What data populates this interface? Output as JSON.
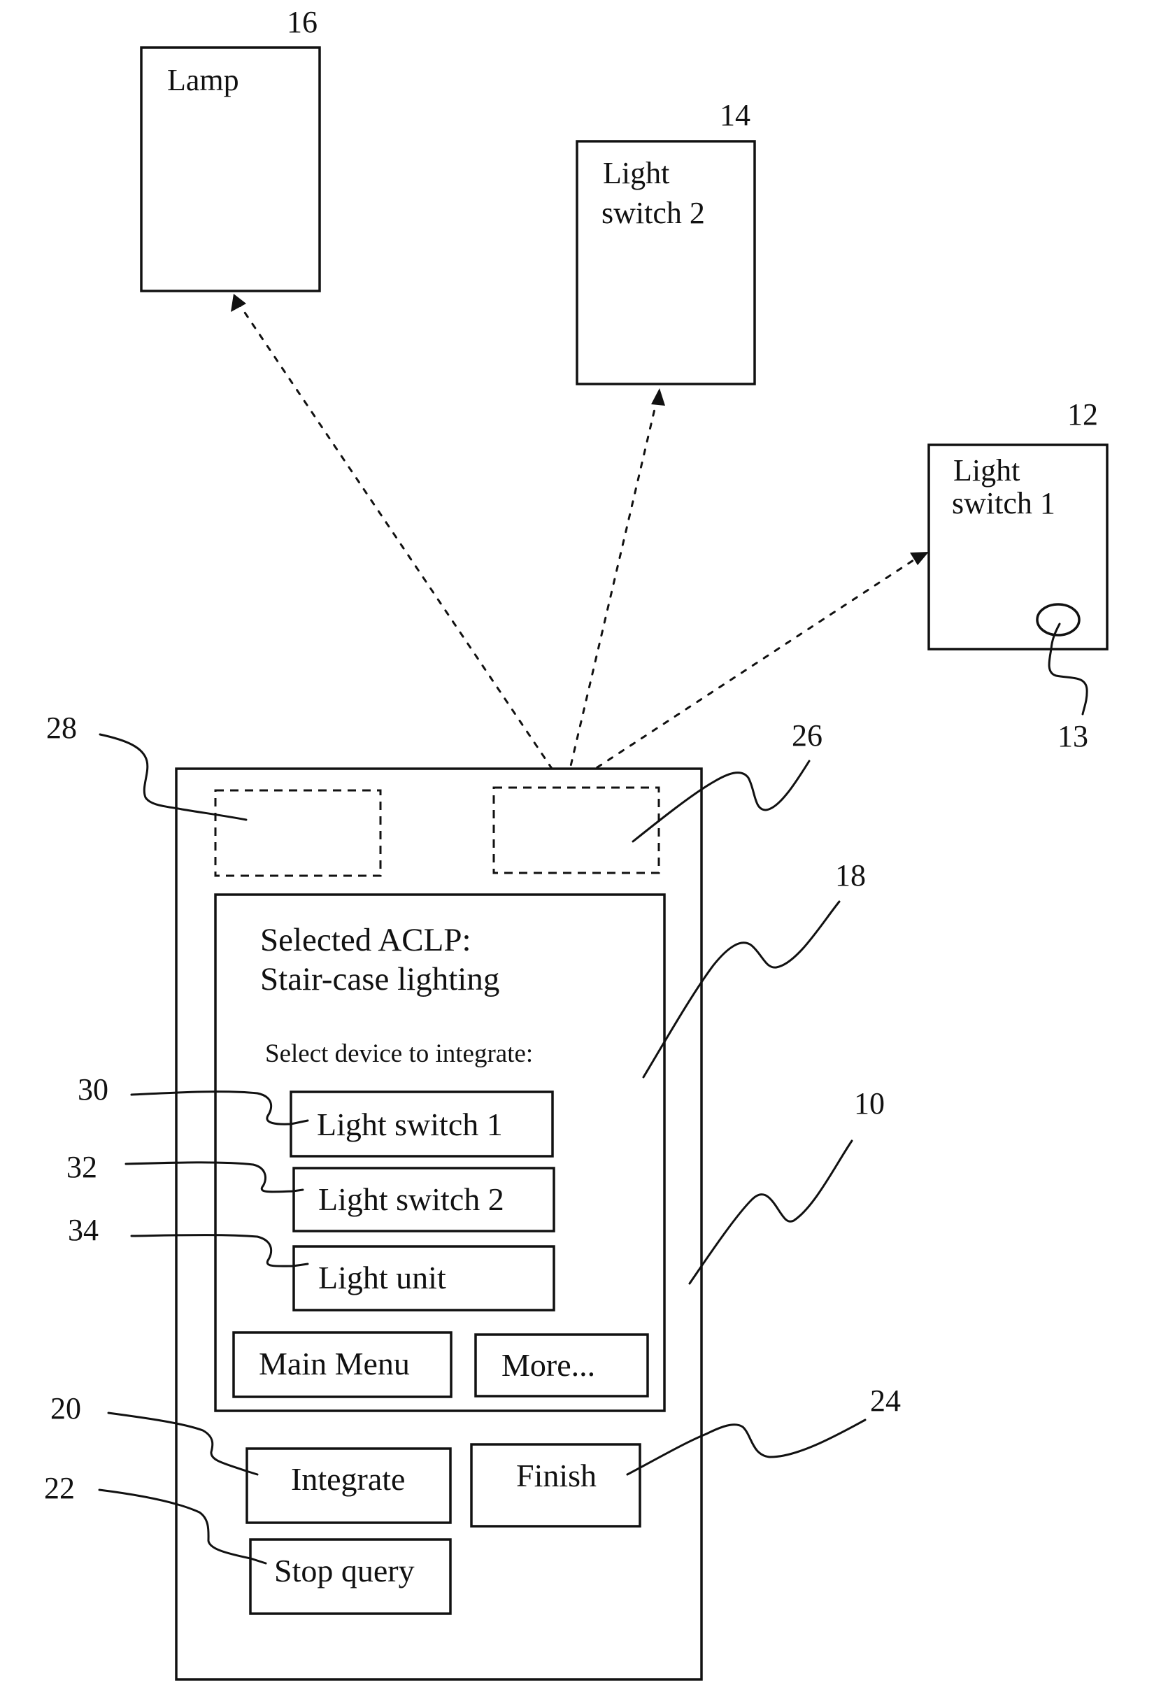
{
  "figure": {
    "devices": {
      "lamp": {
        "ref": "16",
        "label_lines": [
          "Lamp"
        ]
      },
      "light_switch_2": {
        "ref": "14",
        "label_lines": [
          "Light",
          "switch 2"
        ]
      },
      "light_switch_1": {
        "ref": "12",
        "label_lines": [
          "Light",
          "switch 1"
        ],
        "button_ref": "13"
      }
    },
    "phone": {
      "ref": "10",
      "module_left_ref": "28",
      "module_right_ref": "26",
      "screen": {
        "ref": "18",
        "title_line1": "Selected ACLP:",
        "title_line2": "Stair-case lighting",
        "prompt": "Select device to integrate:",
        "device_options": [
          {
            "ref": "30",
            "label": "Light switch 1"
          },
          {
            "ref": "32",
            "label": "Light switch 2"
          },
          {
            "ref": "34",
            "label": "Light unit"
          }
        ],
        "main_menu_label": "Main Menu",
        "more_label": "More..."
      },
      "integrate": {
        "ref": "20",
        "label": "Integrate"
      },
      "stop_query": {
        "ref": "22",
        "label": "Stop query"
      },
      "finish": {
        "ref": "24",
        "label": "Finish"
      }
    }
  }
}
